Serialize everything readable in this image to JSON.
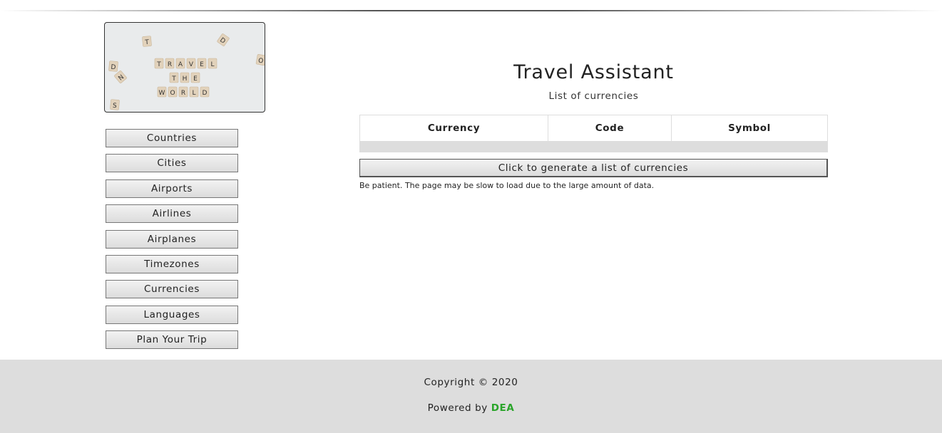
{
  "logo": {
    "tiles": [
      "T",
      "D",
      "T",
      "R",
      "A",
      "V",
      "E",
      "L",
      "T",
      "H",
      "E",
      "W",
      "O",
      "R",
      "L",
      "D",
      "D",
      "N",
      "S",
      "O"
    ]
  },
  "nav": {
    "items": [
      {
        "label": "Countries"
      },
      {
        "label": "Cities"
      },
      {
        "label": "Airports"
      },
      {
        "label": "Airlines"
      },
      {
        "label": "Airplanes"
      },
      {
        "label": "Timezones"
      },
      {
        "label": "Currencies"
      },
      {
        "label": "Languages"
      },
      {
        "label": "Plan Your Trip"
      }
    ]
  },
  "main": {
    "title": "Travel Assistant",
    "subtitle": "List of currencies",
    "table": {
      "headers": [
        "Currency",
        "Code",
        "Symbol"
      ]
    },
    "generate_label": "Click to generate a list of currencies",
    "note": "Be patient. The page may be slow to load due to the large amount of data."
  },
  "footer": {
    "copyright": "Copyright © 2020",
    "powered_prefix": "Powered by ",
    "brand": "DEA",
    "brand_color": "#2aa52a"
  }
}
